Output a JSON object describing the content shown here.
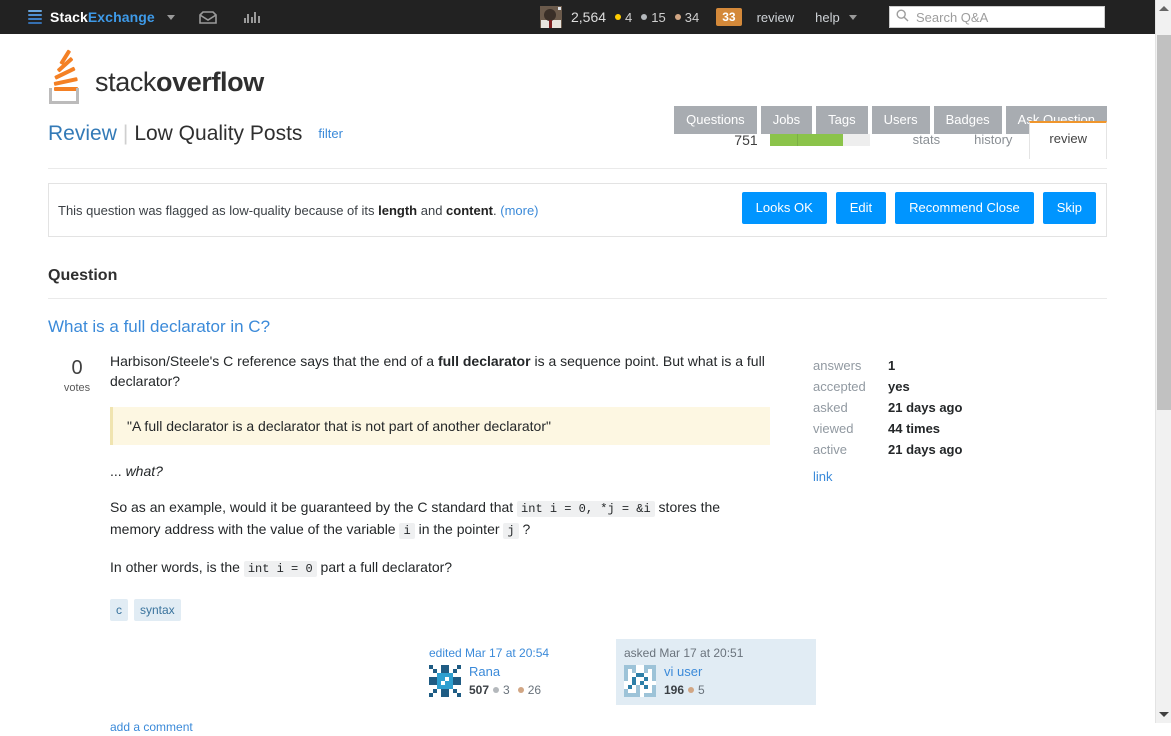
{
  "se_bar": {
    "brand_prefix": "Stack",
    "brand_suffix": "Exchange",
    "inbox_icon": "inbox-icon",
    "achievements_icon": "achievements-icon",
    "reputation": "2,564",
    "gold_badges": "4",
    "silver_badges": "15",
    "bronze_badges": "34",
    "review_count": "33",
    "review_label": "review",
    "help_label": "help",
    "search_placeholder": "Search Q&A",
    "search_value": "",
    "search_icon": "search-icon"
  },
  "so_header": {
    "logo_text_light": "stack",
    "logo_text_bold": "overflow",
    "nav": [
      {
        "label": "Questions"
      },
      {
        "label": "Jobs"
      },
      {
        "label": "Tags"
      },
      {
        "label": "Users"
      },
      {
        "label": "Badges"
      },
      {
        "label": "Ask Question"
      }
    ]
  },
  "review_header": {
    "review_label": "Review",
    "separator": "|",
    "queue_name": "Low Quality Posts",
    "filter_label": "filter",
    "progress_count": "751",
    "progress_percent": 73,
    "tabs": [
      {
        "label": "stats",
        "active": false
      },
      {
        "label": "history",
        "active": false
      },
      {
        "label": "review",
        "active": true
      }
    ]
  },
  "notice": {
    "text_before": "This question was flagged as low-quality because of its ",
    "reason_one": "length",
    "text_middle": " and ",
    "reason_two": "content",
    "text_after": ". ",
    "more_label": "(more)",
    "actions": [
      {
        "label": "Looks OK"
      },
      {
        "label": "Edit"
      },
      {
        "label": "Recommend Close"
      },
      {
        "label": "Skip"
      }
    ]
  },
  "question": {
    "section_heading": "Question",
    "title": "What is a full declarator in C?",
    "votes_count": "0",
    "votes_label": "votes",
    "para1_before": "Harbison/Steele's C reference says that the end of a ",
    "para1_bold": "full declarator",
    "para1_after": " is a sequence point. But what is a full declarator?",
    "quote": "\"A full declarator is a declarator that is not part of another declarator\"",
    "para2_prefix": "... ",
    "para2_italic": "what?",
    "para3_a": "So as an example, would it be guaranteed by the C standard that ",
    "para3_code1": "int i = 0, *j = &i",
    "para3_b": " stores the memory address with the value of the variable ",
    "para3_code2": "i",
    "para3_c": " in the pointer ",
    "para3_code3": "j",
    "para3_d": " ?",
    "para4_a": "In other words, is the ",
    "para4_code": "int i = 0",
    "para4_b": " part a full declarator?",
    "tags": [
      {
        "label": "c"
      },
      {
        "label": "syntax"
      }
    ],
    "stats": [
      {
        "key": "answers",
        "value": "1"
      },
      {
        "key": "accepted",
        "value": "yes"
      },
      {
        "key": "asked",
        "value": "21 days ago"
      },
      {
        "key": "viewed",
        "value": "44 times"
      },
      {
        "key": "active",
        "value": "21 days ago"
      }
    ],
    "link_label": "link",
    "edited": {
      "when": "edited Mar 17 at 20:54",
      "user": "Rana",
      "reputation": "507",
      "silver": "3",
      "bronze": "26",
      "avatar_icon": "identicon-avatar"
    },
    "asked": {
      "when": "asked Mar 17 at 20:51",
      "user": "vi user",
      "reputation": "196",
      "bronze": "5",
      "avatar_icon": "identicon-avatar"
    },
    "add_comment_label": "add a comment"
  },
  "colors": {
    "accent_blue": "#0095ff",
    "link_blue": "#3b8ad9",
    "orange": "#f48024",
    "progress_green": "#8bc34a",
    "review_badge": "#d4893a"
  }
}
